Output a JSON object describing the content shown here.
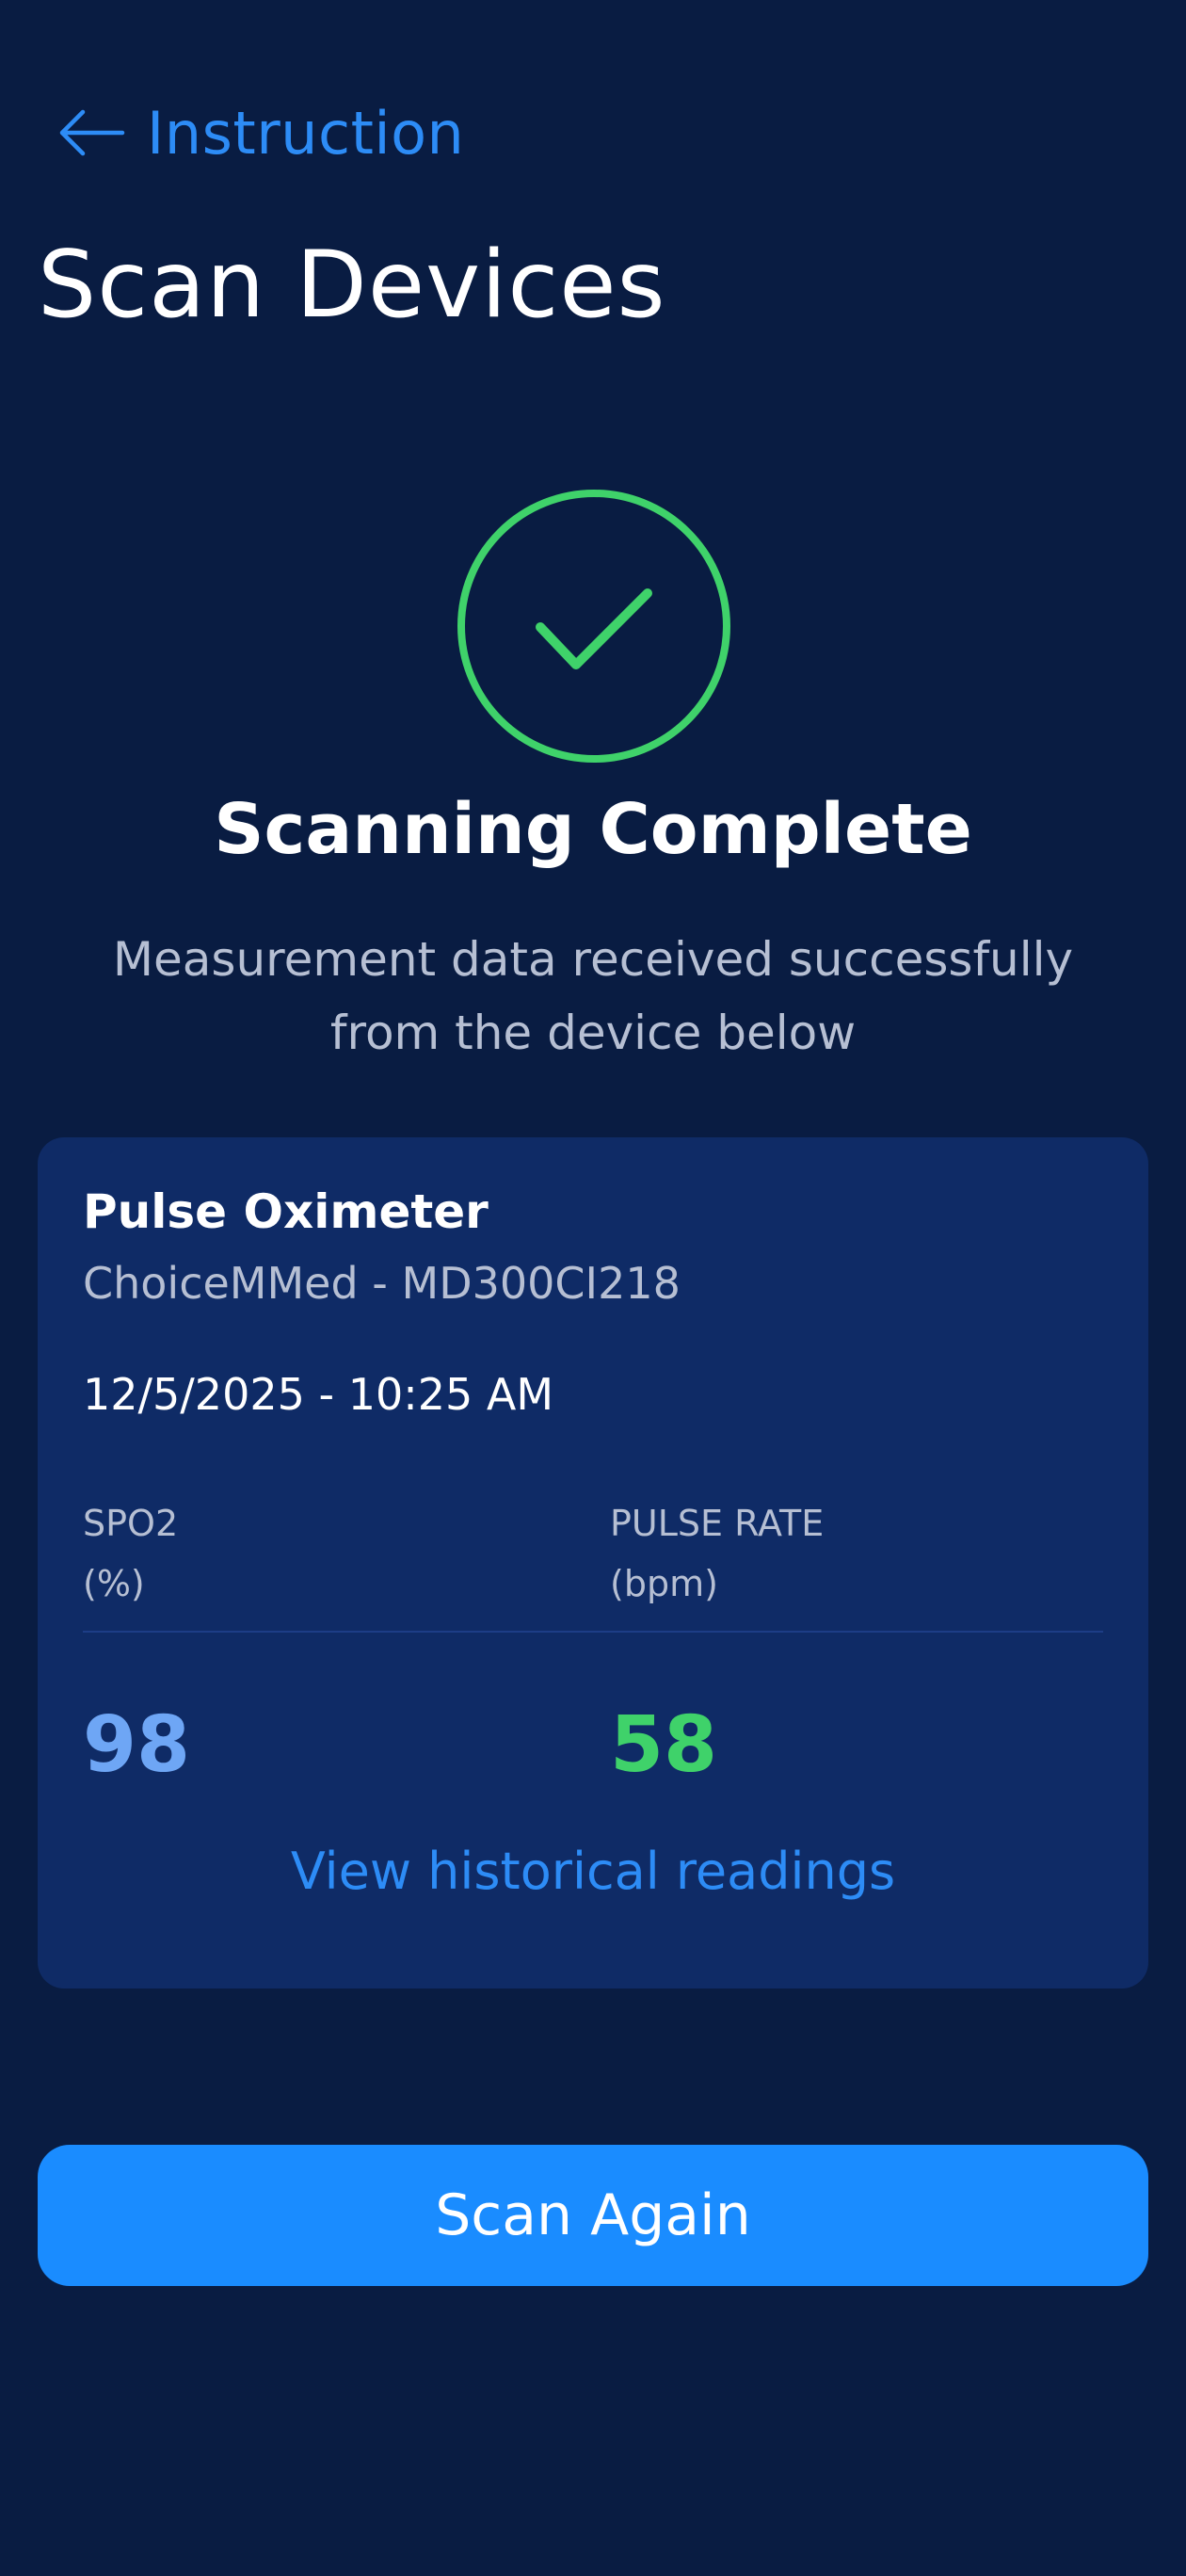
{
  "colors": {
    "background": "#091c42",
    "card": "#0f2b66",
    "accent_blue": "#2d8cf6",
    "success_green": "#3fd26a",
    "spo2_value": "#6ea6f5",
    "button": "#1a8cff"
  },
  "nav": {
    "back_icon": "arrow-left-icon",
    "back_label": "Instruction"
  },
  "page": {
    "title": "Scan Devices"
  },
  "status": {
    "icon": "check-circle-icon",
    "title": "Scanning Complete",
    "description": "Measurement data received successfully from the device below"
  },
  "device": {
    "name": "Pulse Oximeter",
    "model": "ChoiceMMed - MD300CI218",
    "datetime": "12/5/2025 - 10:25 AM",
    "metrics": [
      {
        "label": "SPO2",
        "unit": "(%)",
        "value": "98"
      },
      {
        "label": "PULSE RATE",
        "unit": "(bpm)",
        "value": "58"
      }
    ],
    "history_link": "View historical readings"
  },
  "actions": {
    "scan_again": "Scan Again"
  }
}
